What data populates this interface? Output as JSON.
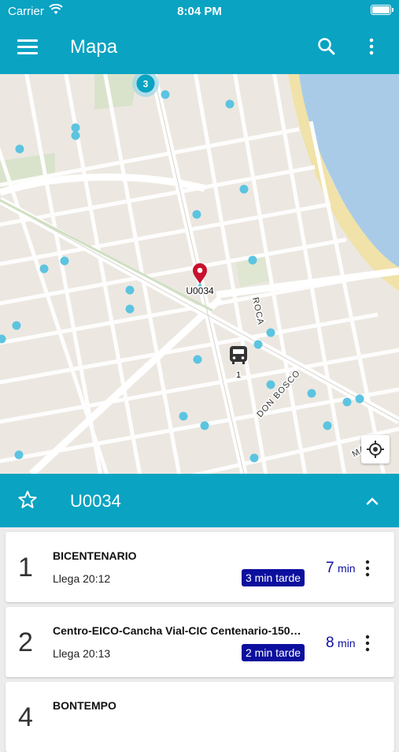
{
  "status_bar": {
    "carrier": "Carrier",
    "time": "8:04 PM"
  },
  "app_bar": {
    "title": "Mapa"
  },
  "map": {
    "cluster_count": "3",
    "selected_stop_label": "U0034",
    "bus_label": "1",
    "street_labels": [
      "ROCA",
      "DON BOSCO",
      "MAIPU"
    ]
  },
  "sheet": {
    "stop_code": "U0034"
  },
  "arrivals": [
    {
      "number": "1",
      "name": "BICENTENARIO",
      "arrives": "Llega 20:12",
      "delay": "3 min tarde",
      "eta_value": "7",
      "eta_unit": "min"
    },
    {
      "number": "2",
      "name": "Centro-EICO-Cancha Vial-CIC Centenario-150…",
      "arrives": "Llega 20:13",
      "delay": "2 min tarde",
      "eta_value": "8",
      "eta_unit": "min"
    },
    {
      "number": "4",
      "name": "BONTEMPO",
      "arrives": "",
      "delay": "",
      "eta_value": "",
      "eta_unit": ""
    }
  ],
  "colors": {
    "brand": "#0aa3c2",
    "badge": "#0c0f9e",
    "stop_dot": "#5cc4e0",
    "pin": "#c8102e"
  }
}
